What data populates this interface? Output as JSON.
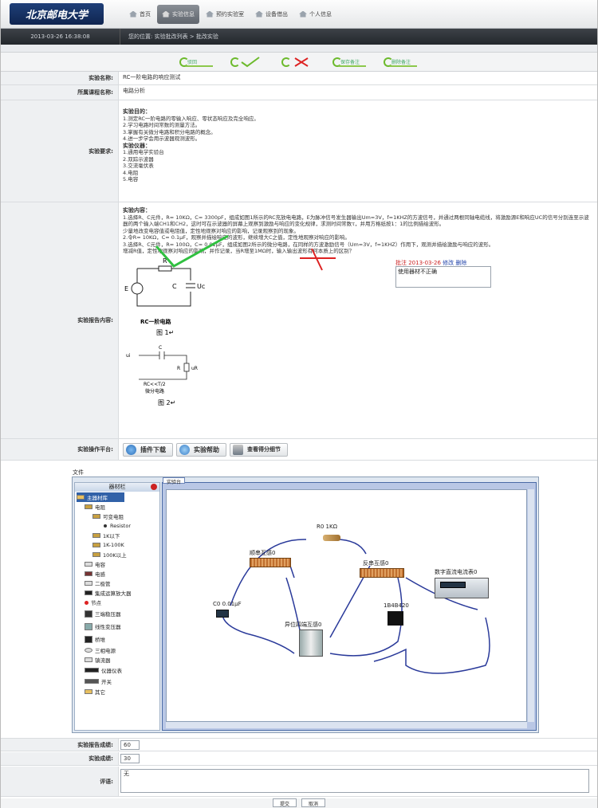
{
  "header": {
    "logo": "北京邮电大学",
    "nav": [
      {
        "label": "首页",
        "active": false
      },
      {
        "label": "实验信息",
        "active": true
      },
      {
        "label": "预约实验室",
        "active": false
      },
      {
        "label": "设备借出",
        "active": false
      },
      {
        "label": "个人信息",
        "active": false
      }
    ]
  },
  "statusbar": {
    "datetime": "2013-03-26 16:38:08",
    "breadcrumb": "您的位置: 实验批改列表 > 批改实验"
  },
  "toolbar": {
    "buttons": [
      {
        "label": "驳回",
        "icon": "reject-circle-icon"
      },
      {
        "label": "",
        "icon": "check-icon"
      },
      {
        "label": "",
        "icon": "cross-icon"
      },
      {
        "label": "保存备注",
        "icon": "save-note-icon"
      },
      {
        "label": "删除备注",
        "icon": "delete-note-icon"
      }
    ]
  },
  "fields": {
    "name_label": "实验名称:",
    "name_value": "RC一阶电路的响应测试",
    "course_label": "所属课程名称:",
    "course_value": "电路分析",
    "req_label": "实验要求:",
    "content_label": "实验报告内容:",
    "platform_label": "实验操作平台:"
  },
  "requirements": {
    "goal_title": "实验目的：",
    "goals": [
      "1.测定RC一阶电路的零输入响应、零状态响应及完全响应。",
      "2.学习电路时间常数的测量方法。",
      "3.掌握有关微分电路和积分电路的概念。",
      "4.进一步学会用示波器观测波形。"
    ],
    "device_title": "实验仪器：",
    "devices": [
      "1.通用电学实验台",
      "2.双踪示波器",
      "3.交流毫伏表",
      "4.电阻",
      "5.电容"
    ]
  },
  "content": {
    "title": "实验内容：",
    "lines": [
      "1.选择R、C元件，R= 10KΩ，C= 3300pF，组成如图1所示的RC充放电电路，E为脉冲信号发生器输出Um=3V，f=1KHZ的方波信号，并通过两根同轴电缆线，将激励源E和响应UC的信号分别连至示波器的两个输入端CH1和CH2，这时可在示波器的屏幕上观察到激励与响应的变化规律，求测时间常数τ，并用方格纸按1：1的比例描绘波形。",
      "少量地改变电容值或电阻值，定性地观察对响应的影响，记录观察到的现象。",
      "2.令R= 10KΩ，C= 0.1μF，观察并描绘响应的波形，继续增大C之值，定性地观察对响应的影响。",
      "3.选择R、C元件，R= 100Ω，C= 0.01μF，组成如图2所示的微分电路，在同样的方波激励信号（Um=3V，f=1KHZ）作用下，观测并描绘激励与响应的波形。",
      "增减R值，定性地观察对响应的影响，并作记录，当R增至1MΩ时，输入输出波形有何本质上的区别？"
    ],
    "note_label": "批注 2013-03-26",
    "note_actions": "修改 删除",
    "note_text": "使用器材不正确",
    "fig1": {
      "r": "R",
      "e": "E",
      "c": "C",
      "uc": "Uc",
      "title": "RC一阶电路",
      "caption": "图 1↵"
    },
    "fig2": {
      "c": "C",
      "r": "R",
      "ui": "ui",
      "ur": "uR",
      "sub1": "RC<<T/2",
      "sub2": "微分电路",
      "caption": "图 2↵"
    }
  },
  "platform": {
    "buttons": [
      {
        "label": "插件下载",
        "icon": "plugin-download-icon"
      },
      {
        "label": "实验帮助",
        "icon": "help-icon"
      },
      {
        "label": "查看得分细节",
        "icon": "score-detail-icon"
      }
    ],
    "menu": "文件"
  },
  "sim": {
    "toolbox_title": "器材栏",
    "tab": "实验台",
    "tree": [
      {
        "label": "主器材库",
        "depth": 0
      },
      {
        "label": "电阻",
        "depth": 1
      },
      {
        "label": "可变电阻",
        "depth": 2
      },
      {
        "label": "Resistor",
        "depth": 3
      },
      {
        "label": "1K以下",
        "depth": 2
      },
      {
        "label": "1K-100K",
        "depth": 2
      },
      {
        "label": "100K以上",
        "depth": 2
      },
      {
        "label": "电容",
        "depth": 1
      },
      {
        "label": "电感",
        "depth": 1
      },
      {
        "label": "二极管",
        "depth": 1
      },
      {
        "label": "集成运算放大器",
        "depth": 1
      },
      {
        "label": "节点",
        "depth": 1
      },
      {
        "label": "三端稳压器",
        "depth": 1
      },
      {
        "label": "线性变压器",
        "depth": 1
      },
      {
        "label": "桥堆",
        "depth": 1
      },
      {
        "label": "三相电源",
        "depth": 1
      },
      {
        "label": "镇流器",
        "depth": 1
      },
      {
        "label": "仪器仪表",
        "depth": 1
      },
      {
        "label": "开关",
        "depth": 1
      },
      {
        "label": "其它",
        "depth": 1
      }
    ],
    "components": [
      {
        "label": "R0  1KΩ"
      },
      {
        "label": "顺串互感0"
      },
      {
        "label": "反串互感0"
      },
      {
        "label": "数字直流电流表0"
      },
      {
        "label": "C0  0.01μF"
      },
      {
        "label": "异位四端互感0"
      },
      {
        "label": "1B4B420"
      }
    ]
  },
  "grading": {
    "report_label": "实验报告成绩:",
    "report_value": "60",
    "exp_label": "实验成绩:",
    "exp_value": "30",
    "comment_label": "评语:",
    "comment_value": "无",
    "submit": "提交",
    "cancel": "取消"
  }
}
